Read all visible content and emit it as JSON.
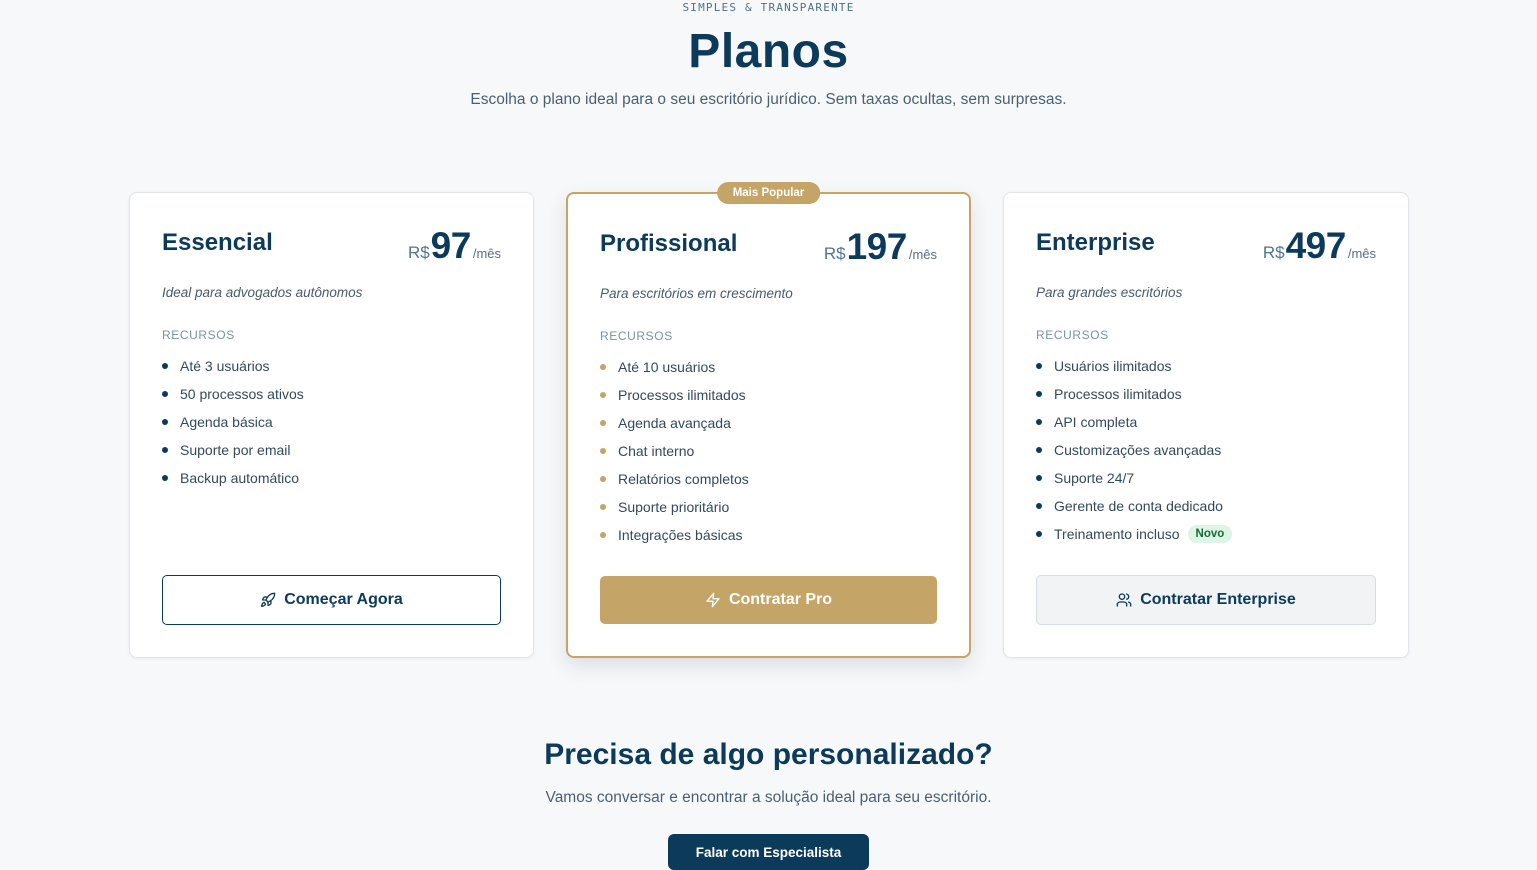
{
  "header": {
    "eyebrow": "SIMPLES & TRANSPARENTE",
    "title": "Planos",
    "subtitle": "Escolha o plano ideal para o seu escritório jurídico. Sem taxas ocultas, sem surpresas."
  },
  "plans": [
    {
      "name": "Essencial",
      "currency": "R$",
      "price": "97",
      "period": "/mês",
      "description": "Ideal para advogados autônomos",
      "features_label": "RECURSOS",
      "features": [
        "Até 3 usuários",
        "50 processos ativos",
        "Agenda básica",
        "Suporte por email",
        "Backup automático"
      ],
      "cta": "Começar Agora",
      "cta_icon": "rocket-icon"
    },
    {
      "badge": "Mais Popular",
      "name": "Profissional",
      "currency": "R$",
      "price": "197",
      "period": "/mês",
      "description": "Para escritórios em crescimento",
      "features_label": "RECURSOS",
      "features": [
        "Até 10 usuários",
        "Processos ilimitados",
        "Agenda avançada",
        "Chat interno",
        "Relatórios completos",
        "Suporte prioritário",
        "Integrações básicas"
      ],
      "cta": "Contratar Pro",
      "cta_icon": "lightning-icon"
    },
    {
      "name": "Enterprise",
      "currency": "R$",
      "price": "497",
      "period": "/mês",
      "description": "Para grandes escritórios",
      "features_label": "RECURSOS",
      "features": [
        "Usuários ilimitados",
        "Processos ilimitados",
        "API completa",
        "Customizações avançadas",
        "Suporte 24/7",
        "Gerente de conta dedicado",
        "Treinamento incluso"
      ],
      "new_badge": "Novo",
      "cta": "Contratar Enterprise",
      "cta_icon": "users-icon"
    }
  ],
  "custom": {
    "title": "Precisa de algo personalizado?",
    "subtitle": "Vamos conversar e encontrar a solução ideal para seu escritório.",
    "button": "Falar com Especialista"
  },
  "colors": {
    "navy": "#0c3a5b",
    "gold": "#c4a467",
    "background": "#f7f8fa",
    "new_badge_bg": "#dcf5e4"
  }
}
